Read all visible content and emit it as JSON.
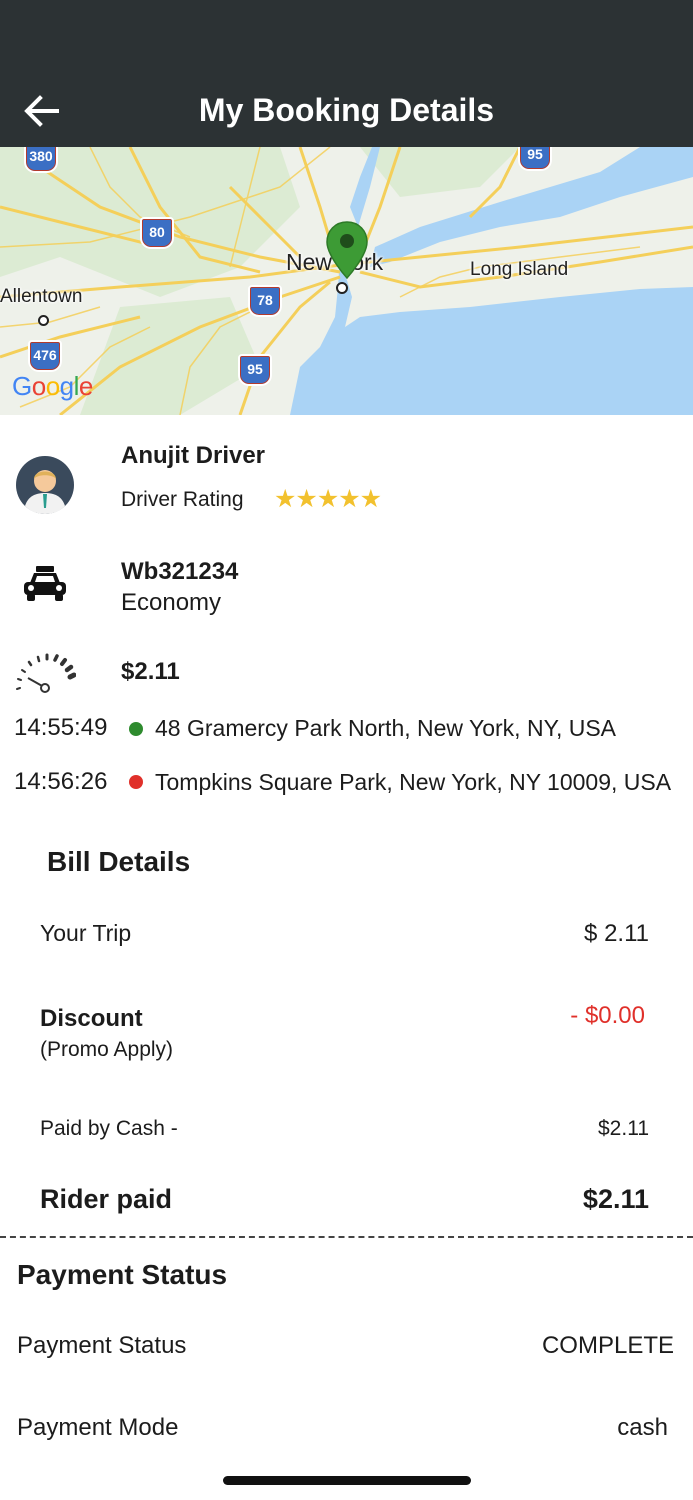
{
  "header": {
    "title": "My Booking Details",
    "back_icon": "arrow-left-icon"
  },
  "map": {
    "labels": {
      "new_york": "New York",
      "long_island": "Long Island",
      "allentown": "Allentown"
    },
    "shields": {
      "i380": "380",
      "i80": "80",
      "i95_top": "95",
      "i78": "78",
      "i476": "476",
      "i95": "95"
    },
    "brand": "Google",
    "colors": {
      "water": "#aad3f5",
      "land": "#eef1ea",
      "roads": "#f4cf5a",
      "pin": "#3d9b35"
    }
  },
  "driver": {
    "name": "Anujit Driver",
    "rating_label": "Driver Rating",
    "rating": 5,
    "stars": "★★★★★"
  },
  "vehicle": {
    "plate": "Wb321234",
    "type": "Economy"
  },
  "fare": {
    "amount": "$2.11"
  },
  "locations": [
    {
      "time": "14:55:49",
      "address": "48 Gramercy Park North, New York, NY, USA",
      "dot_color": "#2e8b2e"
    },
    {
      "time": "14:56:26",
      "address": "Tompkins Square Park, New York, NY 10009, USA",
      "dot_color": "#e0302a"
    }
  ],
  "bill": {
    "title": "Bill Details",
    "your_trip_label": "Your Trip",
    "your_trip_value": "$ 2.11",
    "discount_label": "Discount",
    "discount_sub": "(Promo Apply)",
    "discount_value": "- $0.00",
    "paid_by_label": "Paid by Cash -",
    "paid_by_value": "$2.11",
    "rider_paid_label": "Rider paid",
    "rider_paid_value": "$2.11"
  },
  "payment": {
    "title": "Payment Status",
    "status_label": "Payment Status",
    "status_value": "COMPLETE",
    "mode_label": "Payment Mode",
    "mode_value": "cash"
  }
}
